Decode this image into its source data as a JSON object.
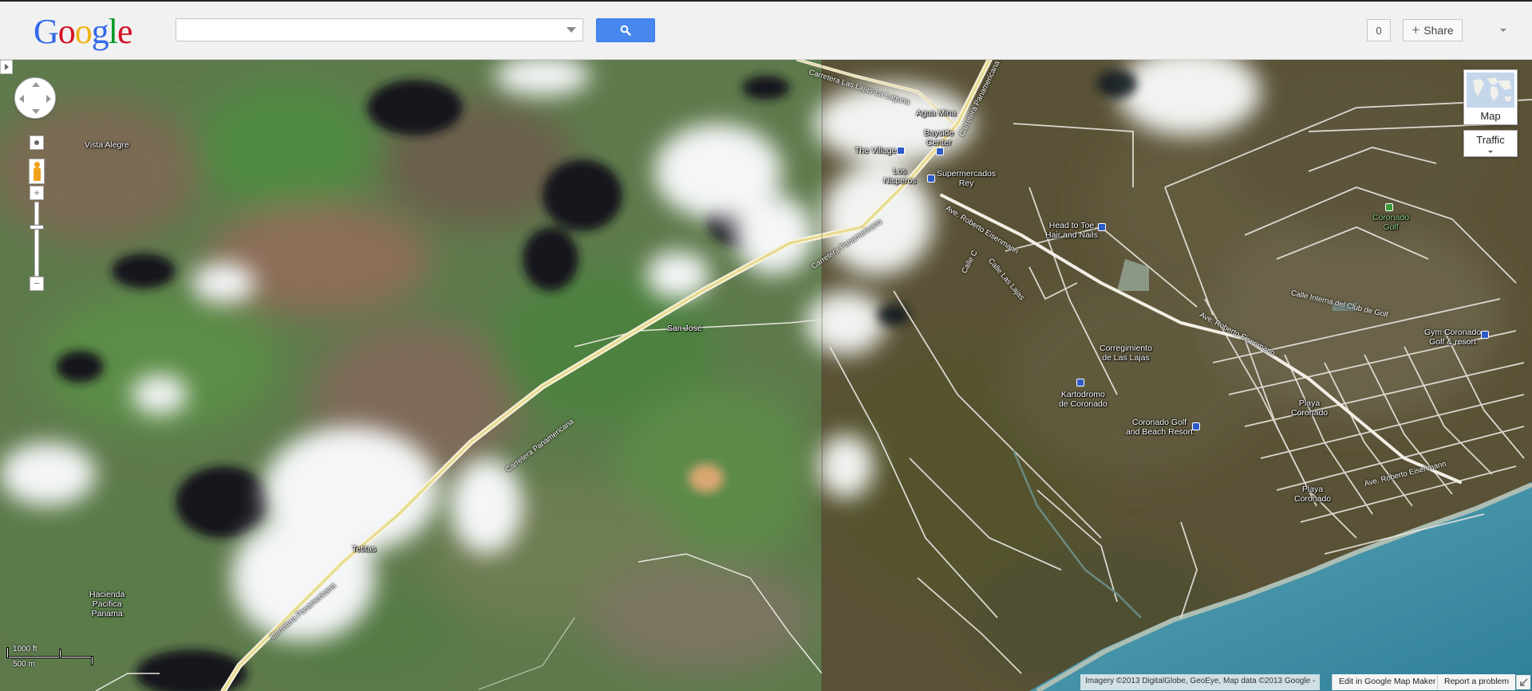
{
  "header": {
    "logo_letters": [
      "G",
      "o",
      "o",
      "g",
      "l",
      "e"
    ],
    "logo_colors": [
      "#3369e8",
      "#d50f25",
      "#eeb211",
      "#3369e8",
      "#009925",
      "#d50f25"
    ],
    "search_value": "",
    "share_count": "0",
    "share_label": "Share",
    "accent_color": "#4787ed"
  },
  "map_controls": {
    "map_type_label": "Map",
    "traffic_label": "Traffic",
    "zoom_in_symbol": "+",
    "zoom_out_symbol": "−"
  },
  "places": {
    "vista_alegre": "Vista Alegre",
    "san_jose": "San José",
    "tetitas": "Tetitas",
    "hacienda": "Hacienda\nPacifica\nPanama",
    "agua_mina": "Agua Mina",
    "the_village": "The Village",
    "bayside": "Bayside\nCenter",
    "los_nisperos": "Los\nNisperos",
    "supermercados": "Supermercados\nRey",
    "head_to_toe": "Head to Toe\nHair and Nails",
    "coronado_golf_small": "Coronado\nGolf",
    "gym": "Gym Coronado\nGolf & resort",
    "corregimiento": "Corregimiento\nde Las Lajas",
    "kartodromo": "Kartodromo\nde Coronado",
    "golf_beach": "Coronado Golf\nand Beach Resort",
    "playa_coronado_1": "Playa\nCoronado",
    "playa_coronado_2": "Playa\nCoronado"
  },
  "roads": {
    "lajas_laguna": "Carretera Las Lajas-La Laguna",
    "panamericana_1": "Carretera Panamericana",
    "panamericana_2": "Carretera Panamericana",
    "panamericana_3": "Carretera Panamericana",
    "panamericana_4": "Carretera Panamericana",
    "eisenmann_1": "Ave. Roberto Eisenmann",
    "eisenmann_2": "Ave. Roberto Eisenmann",
    "eisenmann_3": "Ave. Roberto Eisenmann",
    "calle_las_lajas": "Calle Las Lajas",
    "calle_club_golf": "Calle Interna del Club de Golf",
    "calle_c": "Calle C"
  },
  "scale": {
    "imperial": "1000 ft",
    "metric": "500 m"
  },
  "footer": {
    "attribution": "Imagery ©2013 DigitalGlobe, GeoEye, Map data ©2013 Google -",
    "edit_link": "Edit in Google Map Maker",
    "report_link": "Report a problem"
  }
}
